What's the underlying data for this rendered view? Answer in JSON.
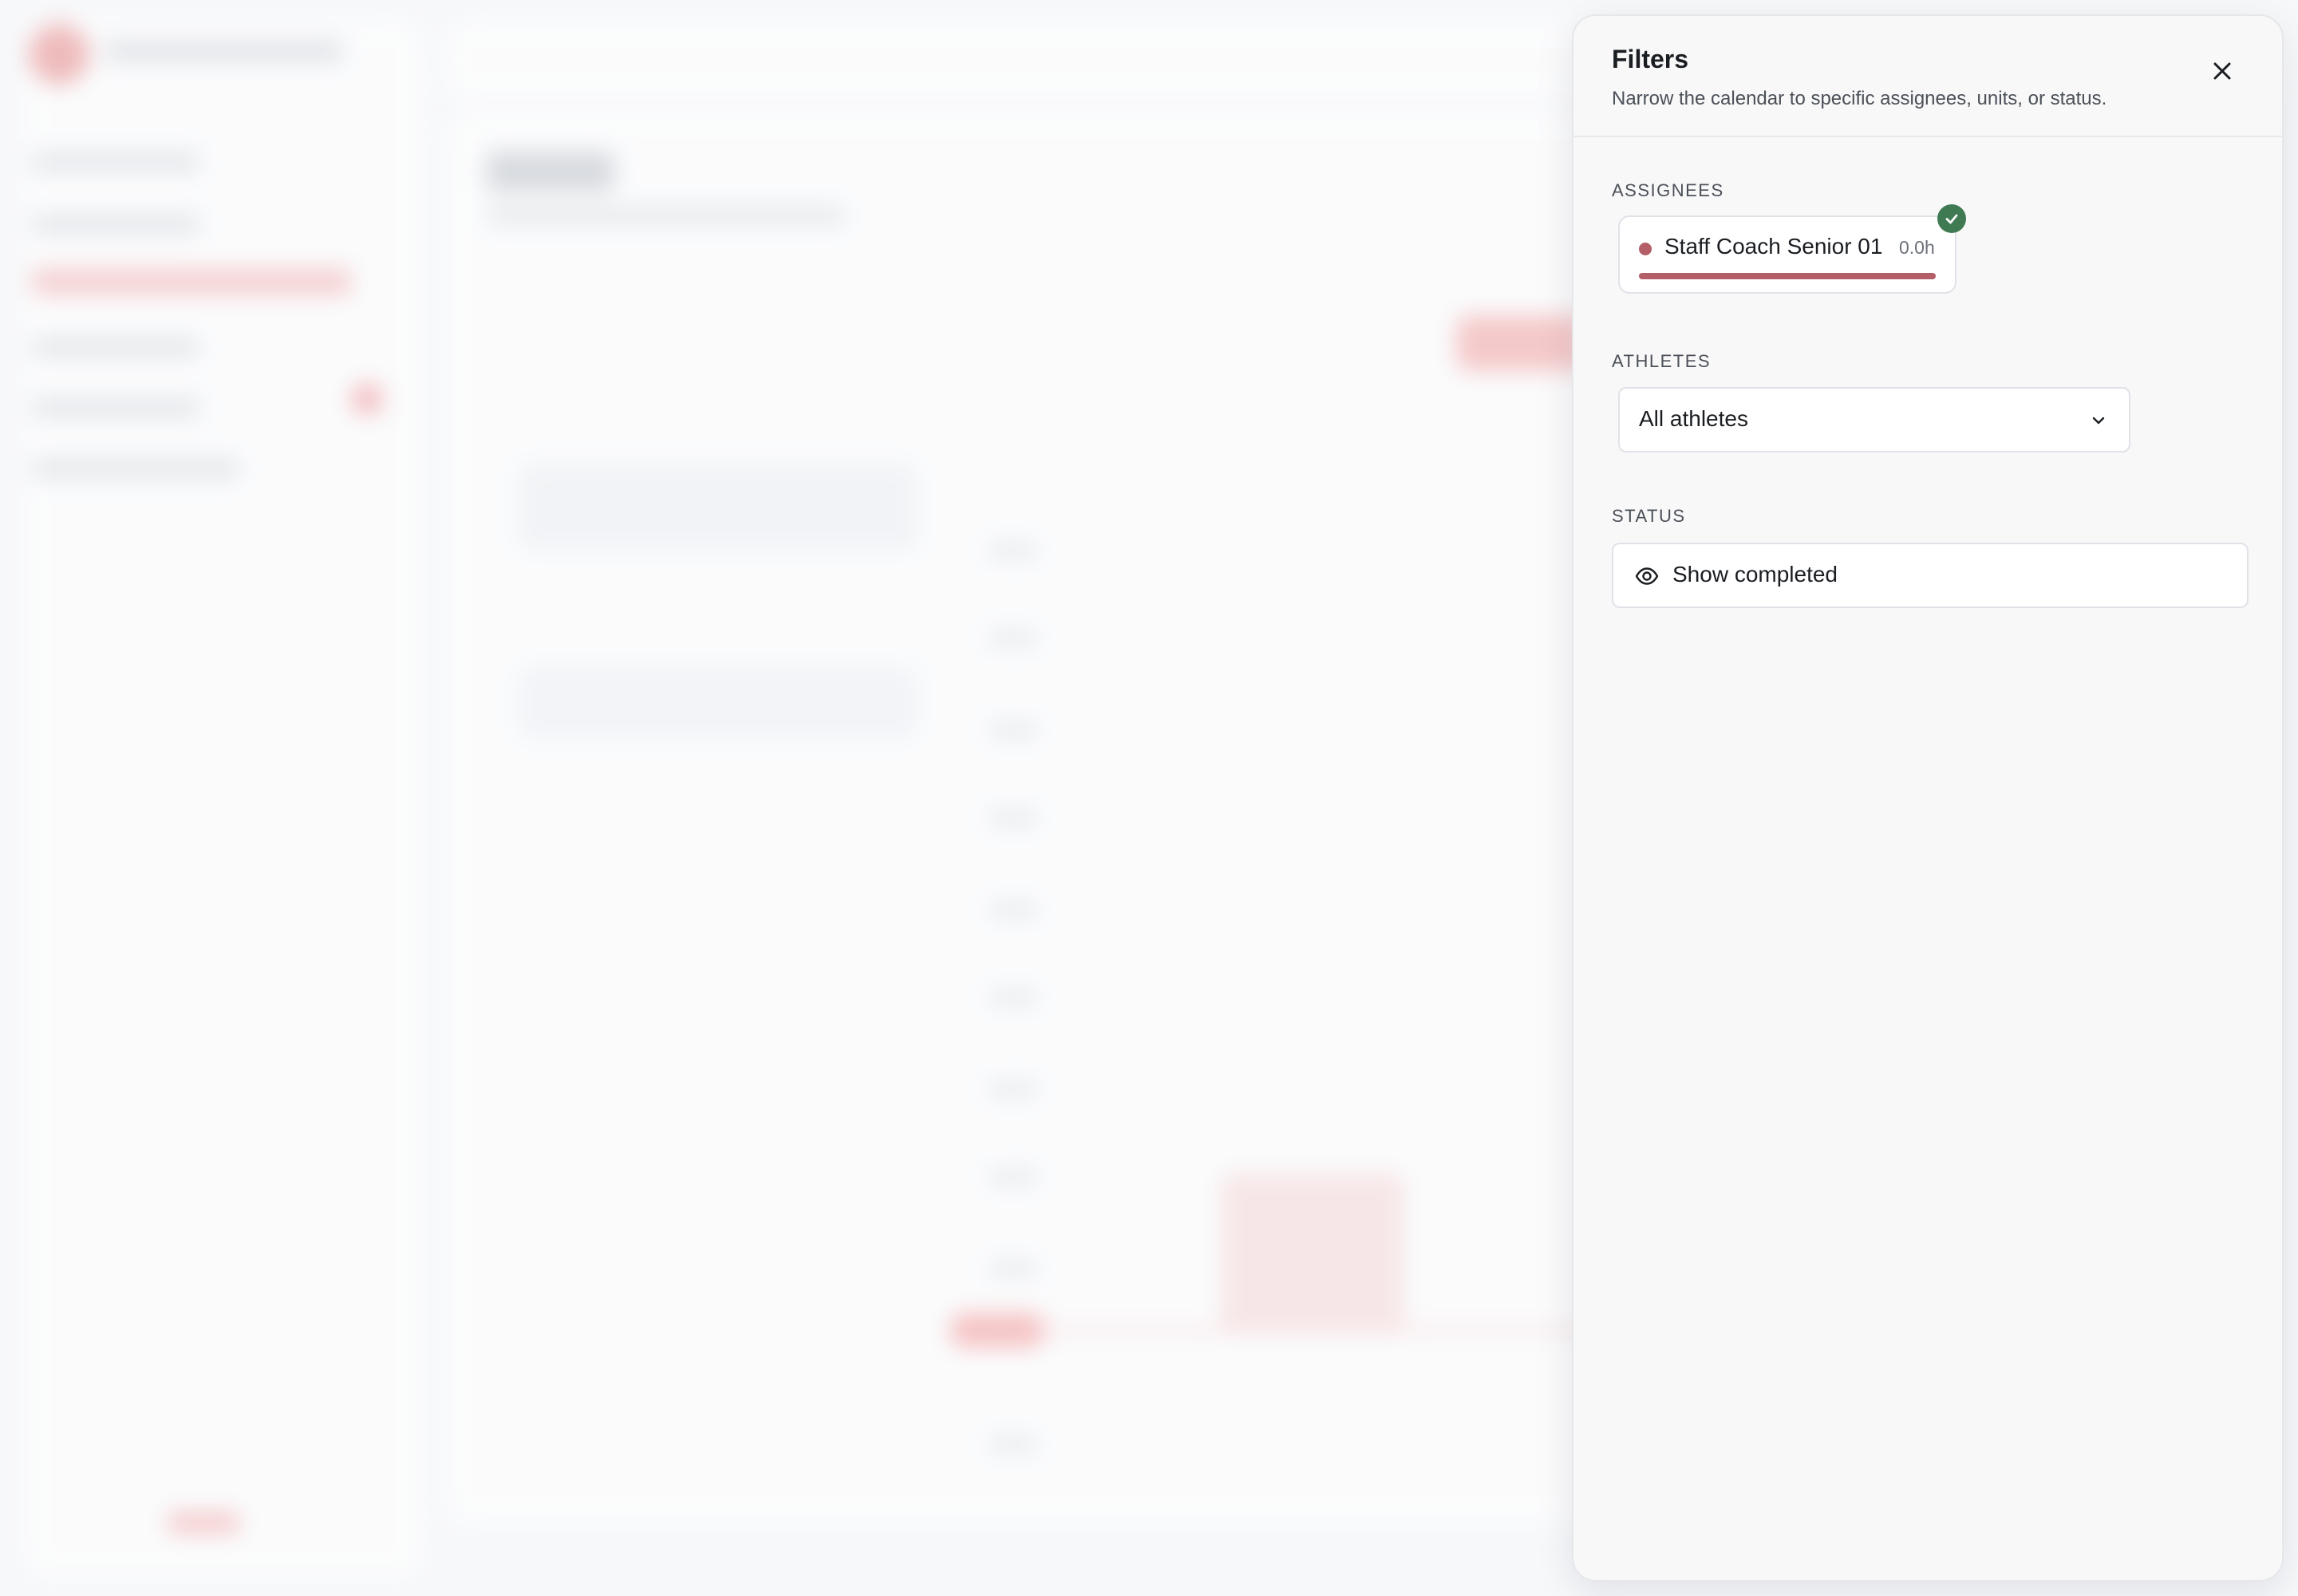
{
  "filters_panel": {
    "title": "Filters",
    "description": "Narrow the calendar to specific assignees, units, or status.",
    "assignees": {
      "label": "ASSIGNEES",
      "items": [
        {
          "name": "Staff Coach Senior 01",
          "hours": "0.0h",
          "selected": true,
          "color": "#b45e67"
        }
      ]
    },
    "athletes": {
      "label": "ATHLETES",
      "selected": "All athletes"
    },
    "status": {
      "label": "STATUS",
      "toggle_label": "Show completed"
    }
  },
  "colors": {
    "accent": "#b45e67",
    "check": "#3f7a52"
  }
}
